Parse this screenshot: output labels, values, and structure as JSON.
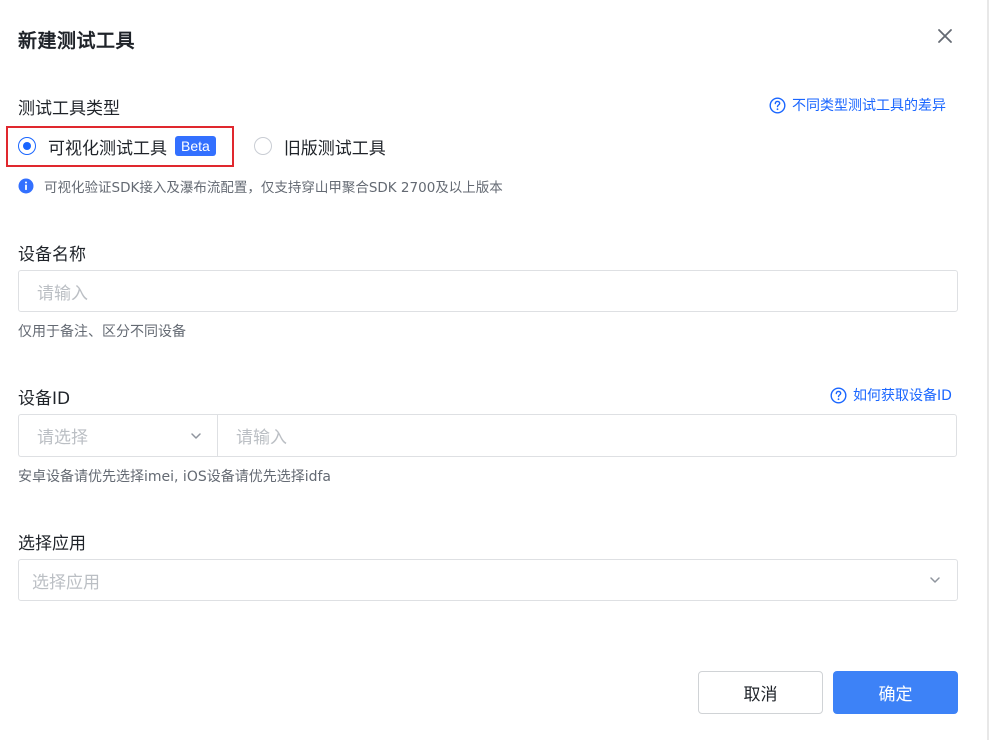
{
  "dialog": {
    "title": "新建测试工具"
  },
  "tool_type": {
    "label": "测试工具类型",
    "help_link": "不同类型测试工具的差异",
    "options": [
      {
        "label": "可视化测试工具",
        "badge": "Beta",
        "checked": true
      },
      {
        "label": "旧版测试工具",
        "checked": false
      }
    ],
    "info": "可视化验证SDK接入及瀑布流配置，仅支持穿山甲聚合SDK 2700及以上版本"
  },
  "device_name": {
    "label": "设备名称",
    "placeholder": "请输入",
    "hint": "仅用于备注、区分不同设备"
  },
  "device_id": {
    "label": "设备ID",
    "help_link": "如何获取设备ID",
    "select_placeholder": "请选择",
    "input_placeholder": "请输入",
    "hint": "安卓设备请优先选择imei, iOS设备请优先选择idfa"
  },
  "app": {
    "label": "选择应用",
    "placeholder": "选择应用"
  },
  "footer": {
    "cancel_label": "取消",
    "ok_label": "确定"
  },
  "colors": {
    "primary": "#3d82f7",
    "link": "#1a66ff",
    "highlight_border": "#e0282e"
  }
}
